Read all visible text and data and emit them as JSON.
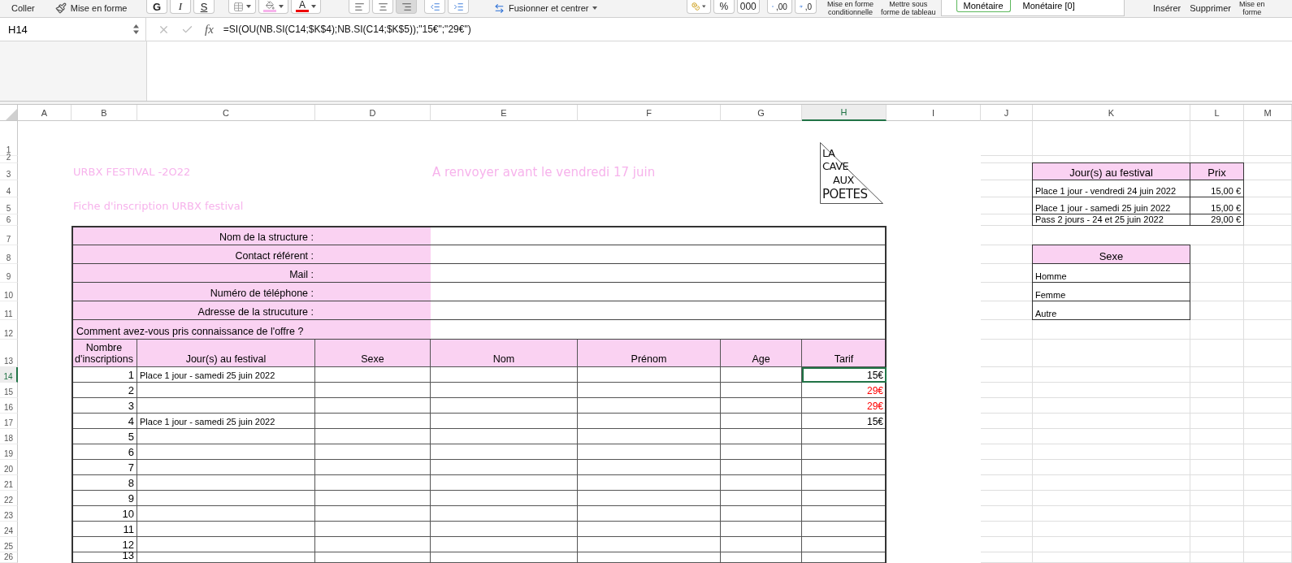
{
  "toolbar": [
    {
      "items": [
        {
          "kind": "paste",
          "label": "Coller"
        },
        {
          "kind": "painter",
          "label": "Mise en forme"
        }
      ]
    },
    {
      "items": [
        {
          "kind": "bold",
          "label": "G"
        },
        {
          "kind": "italic",
          "label": "I"
        },
        {
          "kind": "underline",
          "label": "S"
        },
        {
          "kind": "borders"
        },
        {
          "kind": "fill-color"
        },
        {
          "kind": "font-color",
          "label": "A"
        }
      ]
    },
    {
      "items": [
        {
          "kind": "align-left",
          "selected": false
        },
        {
          "kind": "align-center",
          "selected": false
        },
        {
          "kind": "align-right",
          "selected": true
        },
        {
          "kind": "indent-decrease"
        },
        {
          "kind": "indent-increase"
        },
        {
          "kind": "merge",
          "label": "Fusionner et centrer"
        }
      ]
    },
    {
      "items": [
        {
          "kind": "currency"
        },
        {
          "kind": "percent",
          "label": "%"
        },
        {
          "kind": "thousands",
          "label": "000"
        },
        {
          "kind": "decimal-increase",
          "label": ",00"
        },
        {
          "kind": "decimal-decrease",
          "label": ",0"
        }
      ]
    },
    {
      "items": [
        {
          "kind": "stacked",
          "label": "Mise en forme",
          "label2": "conditionnelle"
        },
        {
          "kind": "stacked",
          "label": "Mettre sous",
          "label2": "forme de tableau"
        },
        {
          "kind": "styles",
          "styles": [
            {
              "label": "Monétaire",
              "selected": true
            },
            {
              "label": "Monétaire [0]",
              "selected": false
            }
          ]
        }
      ]
    },
    {
      "items": [
        {
          "kind": "plain",
          "label": "Insérer"
        },
        {
          "kind": "plain",
          "label": "Supprimer"
        },
        {
          "kind": "stacked",
          "label": "Mise en",
          "label2": "forme"
        }
      ]
    }
  ],
  "name_box": "H14",
  "function_label": "fx",
  "formula": "=SI(OU(NB.SI(C14;$K$4);NB.SI(C14;$K$5));\"15€\";\"29€\")",
  "columns": [
    {
      "label": "A",
      "selected": false
    },
    {
      "label": "B",
      "selected": false
    },
    {
      "label": "C",
      "selected": false
    },
    {
      "label": "D",
      "selected": false
    },
    {
      "label": "E",
      "selected": false
    },
    {
      "label": "F",
      "selected": false
    },
    {
      "label": "G",
      "selected": false
    },
    {
      "label": "H",
      "selected": true
    },
    {
      "label": "I",
      "selected": false
    },
    {
      "label": "J",
      "selected": false
    },
    {
      "label": "K",
      "selected": false
    },
    {
      "label": "L",
      "selected": false
    },
    {
      "label": "M",
      "selected": false
    }
  ],
  "row_headers": [
    {
      "label": "1",
      "selected": false
    },
    {
      "label": "2",
      "selected": false
    },
    {
      "label": "3",
      "selected": false
    },
    {
      "label": "4",
      "selected": false
    },
    {
      "label": "5",
      "selected": false
    },
    {
      "label": "6",
      "selected": false
    },
    {
      "label": "7",
      "selected": false
    },
    {
      "label": "8",
      "selected": false
    },
    {
      "label": "9",
      "selected": false
    },
    {
      "label": "10",
      "selected": false
    },
    {
      "label": "11",
      "selected": false
    },
    {
      "label": "12",
      "selected": false
    },
    {
      "label": "13",
      "selected": false
    },
    {
      "label": "14",
      "selected": true
    },
    {
      "label": "15",
      "selected": false
    },
    {
      "label": "16",
      "selected": false
    },
    {
      "label": "17",
      "selected": false
    },
    {
      "label": "18",
      "selected": false
    },
    {
      "label": "19",
      "selected": false
    },
    {
      "label": "20",
      "selected": false
    },
    {
      "label": "21",
      "selected": false
    },
    {
      "label": "22",
      "selected": false
    },
    {
      "label": "23",
      "selected": false
    },
    {
      "label": "24",
      "selected": false
    },
    {
      "label": "25",
      "selected": false
    },
    {
      "label": "26",
      "selected": false
    }
  ],
  "titles": {
    "event": "URBX FESTIVAL -2O22",
    "deadline": "A renvoyer avant le vendredi 17 juin",
    "form_title": "Fiche d'inscription URBX festival"
  },
  "logo": {
    "lines": [
      "LA",
      "CAVE",
      "AUX",
      "POETES"
    ]
  },
  "structure_fields": [
    {
      "kind": "field",
      "label": "Nom de la structure :"
    },
    {
      "kind": "field",
      "label": "Contact référent :"
    },
    {
      "kind": "field",
      "label": "Mail :"
    },
    {
      "kind": "field",
      "label": "Numéro de téléphone :"
    },
    {
      "kind": "field",
      "label": "Adresse de la strucuture :"
    },
    {
      "kind": "question",
      "label": "Comment avez-vous pris connaissance de l'offre ?"
    }
  ],
  "registrations": {
    "columns": [
      "Nombre d'inscriptions",
      "Jour(s) au festival",
      "Sexe",
      "Nom",
      "Prénom",
      "Age",
      "Tarif"
    ],
    "rows": [
      {
        "number": "1",
        "day": "Place 1 jour - samedi 25 juin 2022",
        "tarif": {
          "text": "15€",
          "color": "#000000"
        },
        "selected": true
      },
      {
        "number": "2",
        "tarif": {
          "text": "29€",
          "color": "#ff0000"
        },
        "selected": false
      },
      {
        "number": "3",
        "tarif": {
          "text": "29€",
          "color": "#ff0000"
        },
        "selected": false
      },
      {
        "number": "4",
        "day": "Place 1 jour - samedi 25 juin 2022",
        "tarif": {
          "text": "15€",
          "color": "#000000"
        },
        "selected": false
      },
      {
        "number": "5",
        "selected": false
      },
      {
        "number": "6",
        "selected": false
      },
      {
        "number": "7",
        "selected": false
      },
      {
        "number": "8",
        "selected": false
      },
      {
        "number": "9",
        "selected": false
      },
      {
        "number": "10",
        "selected": false
      },
      {
        "number": "11",
        "selected": false
      },
      {
        "number": "12",
        "selected": false
      },
      {
        "number": "13",
        "selected": false
      }
    ]
  },
  "price_table": {
    "columns": [
      "Jour(s) au festival",
      "Prix"
    ],
    "rows": [
      {
        "label": "Place 1 jour - vendredi 24 juin 2022",
        "price": "15,00",
        "currency": "€"
      },
      {
        "label": "Place 1 jour - samedi 25 juin 2022",
        "price": "15,00",
        "currency": "€"
      },
      {
        "label": "Pass 2 jours - 24 et 25 juin 2022",
        "price": "29,00",
        "currency": "€"
      }
    ]
  },
  "sexe_table": {
    "title": "Sexe",
    "options": [
      "Homme",
      "Femme",
      "Autre"
    ]
  }
}
